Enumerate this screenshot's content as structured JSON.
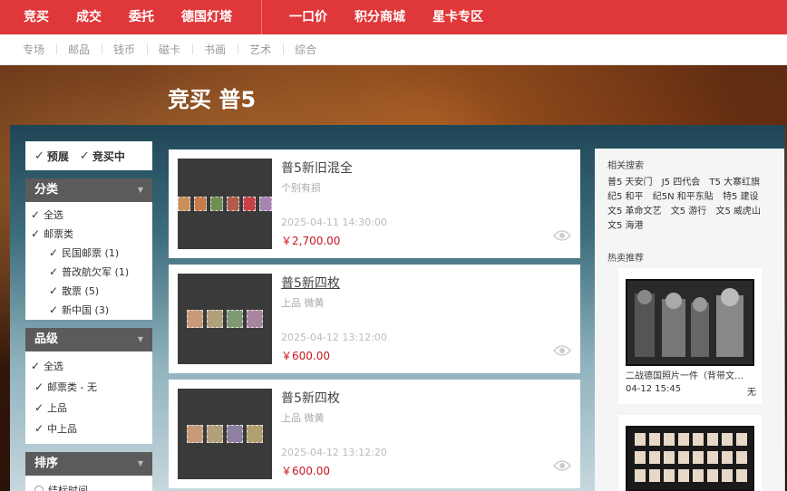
{
  "topnav": {
    "items": [
      "竞买",
      "成交",
      "委托",
      "德国灯塔"
    ],
    "items_right": [
      "一口价",
      "积分商城",
      "星卡专区"
    ]
  },
  "subnav": {
    "items": [
      "专场",
      "邮品",
      "钱币",
      "磁卡",
      "书画",
      "艺术",
      "综合"
    ]
  },
  "page": {
    "title": "竞买 普5"
  },
  "filters": {
    "top": [
      "预展",
      "竞买中"
    ],
    "category": {
      "title": "分类",
      "items": [
        "全选",
        "邮票类",
        "民国邮票 (1)",
        "普改航欠军 (1)",
        "散票 (5)",
        "新中国 (3)"
      ]
    },
    "grade": {
      "title": "品级",
      "items": [
        "全选",
        "邮票类 - 无",
        "上品",
        "中上品"
      ]
    },
    "sort": {
      "title": "排序",
      "first_option": "结标时间"
    }
  },
  "items": [
    {
      "title": "普5新旧混全",
      "desc": "个别有损",
      "time": "2025-04-11 14:30:00",
      "price": "￥2,700.00"
    },
    {
      "title": "普5新四枚",
      "desc": "上品 微黄",
      "time": "2025-04-12 13:12:00",
      "price": "￥600.00"
    },
    {
      "title": "普5新四枚",
      "desc": "上品 微黄",
      "time": "2025-04-12 13:12:20",
      "price": "￥600.00"
    }
  ],
  "related": {
    "title": "相关搜索",
    "tags": [
      "普5 天安门",
      "J5 四代会",
      "T5 大寨红旗",
      "纪5 和平",
      "纪5N 和平东貼",
      "特5 建设",
      "文5 革命文艺",
      "文5 游行",
      "文5 威虎山",
      "文5 海港"
    ]
  },
  "hot": {
    "title": "热卖推荐",
    "items": [
      {
        "caption": "二战德国照片一件（背带文…",
        "date": "04-12 15:45",
        "status": "无"
      }
    ]
  },
  "colors": {
    "brand": "#e0373a",
    "price": "#c8161d"
  }
}
